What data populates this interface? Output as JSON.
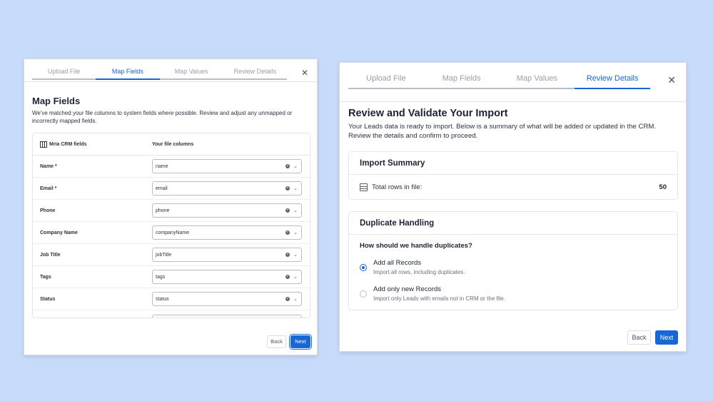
{
  "left_dialog": {
    "tabs": [
      {
        "label": "Upload File",
        "active": false
      },
      {
        "label": "Map Fields",
        "active": true
      },
      {
        "label": "Map Values",
        "active": false
      },
      {
        "label": "Review Details",
        "active": false
      }
    ],
    "close_icon": "close-icon",
    "title": "Map Fields",
    "subtitle": "We've matched your file columns to system fields where possible. Review and adjust any unmapped or incorrectly mapped fields.",
    "table": {
      "col_system": "Mria CRM fields",
      "col_file": "Your file columns",
      "rows": [
        {
          "field": "Name *",
          "value": "name"
        },
        {
          "field": "Email *",
          "value": "email"
        },
        {
          "field": "Phone",
          "value": "phone"
        },
        {
          "field": "Company Name",
          "value": "companyName"
        },
        {
          "field": "Job Title",
          "value": "jobTitle"
        },
        {
          "field": "Tags",
          "value": "tags"
        },
        {
          "field": "Status",
          "value": "status"
        }
      ]
    },
    "back_label": "Back",
    "next_label": "Next"
  },
  "right_dialog": {
    "tabs": [
      {
        "label": "Upload File",
        "active": false
      },
      {
        "label": "Map Fields",
        "active": false
      },
      {
        "label": "Map Values",
        "active": false
      },
      {
        "label": "Review Details",
        "active": true
      }
    ],
    "close_icon": "close-icon",
    "title": "Review and Validate Your Import",
    "subtitle": "Your Leads data is ready to import. Below is a summary of what will be added or updated in the CRM. Review the details and confirm to proceed.",
    "summary": {
      "heading": "Import Summary",
      "rows_label": "Total rows in file:",
      "rows_value": "50"
    },
    "duplicates": {
      "heading": "Duplicate Handling",
      "question": "How should we handle duplicates?",
      "options": [
        {
          "label": "Add all Records",
          "desc": "Import all rows, including duplicates.",
          "selected": true
        },
        {
          "label": "Add only new Records",
          "desc": "Import only Leads with emails not in CRM or the file.",
          "selected": false
        }
      ]
    },
    "back_label": "Back",
    "next_label": "Next"
  },
  "colors": {
    "background": "#c7dcfb",
    "accent": "#1767d6",
    "text": "#1c2333",
    "muted": "#98a0ab"
  }
}
